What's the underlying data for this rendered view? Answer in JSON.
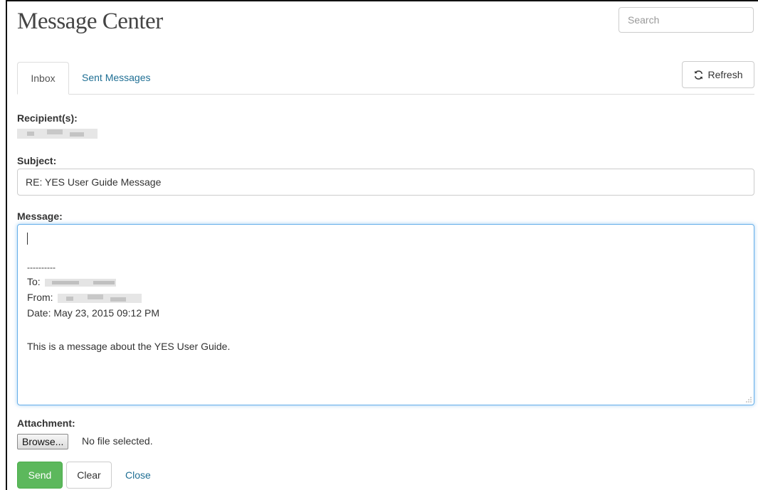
{
  "header": {
    "title": "Message Center"
  },
  "search": {
    "placeholder": "Search"
  },
  "tabs": [
    {
      "label": "Inbox",
      "active": true
    },
    {
      "label": "Sent Messages",
      "active": false
    }
  ],
  "toolbar": {
    "refresh_label": "Refresh",
    "refresh_icon": "refresh-icon"
  },
  "form": {
    "recipients_label": "Recipient(s):",
    "subject_label": "Subject:",
    "subject_value": "RE: YES User Guide Message",
    "message_label": "Message:",
    "message": {
      "separator": "----------",
      "to_label": "To:",
      "from_label": "From:",
      "date_line": "Date: May 23, 2015 09:12 PM",
      "body": "This is a message about the YES User Guide."
    },
    "attachment_label": "Attachment:",
    "browse_label": "Browse...",
    "file_status": "No file selected."
  },
  "actions": {
    "send_label": "Send",
    "clear_label": "Clear",
    "close_label": "Close"
  },
  "colors": {
    "accent_link": "#1f6f94",
    "send_button": "#5cb85c",
    "focus_border": "#66afe9"
  }
}
